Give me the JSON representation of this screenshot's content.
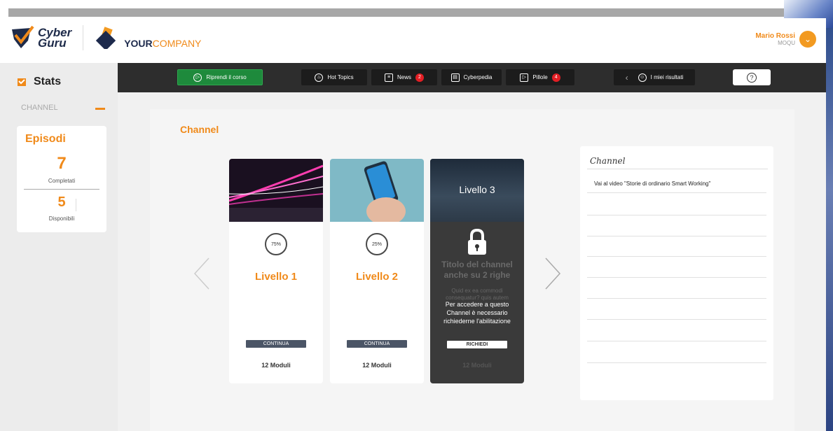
{
  "brand": {
    "cyber_line1": "Cyber",
    "cyber_line2": "Guru",
    "company_your": "YOUR",
    "company_rest": "COMPANY"
  },
  "user": {
    "name": "Mario Rossi",
    "org": "MOQU"
  },
  "sidebar": {
    "stats_label": "Stats",
    "channel_label": "CHANNEL"
  },
  "episodi": {
    "title": "Episodi",
    "completed_count": "7",
    "completed_label": "Completati",
    "available_count": "5",
    "available_label": "Disponibili"
  },
  "nav": {
    "riprendi": "Riprendi il corso",
    "hot_topics": "Hot Topics",
    "news": "News",
    "news_badge": "2",
    "cyberpedia": "Cyberpedia",
    "pillole": "Pillole",
    "pillole_badge": "4",
    "risultati": "I miei risultati"
  },
  "main": {
    "title": "Channel"
  },
  "cards": [
    {
      "level": "Livello 1",
      "progress": "75%",
      "cta": "CONTINUA",
      "modules": "12 Moduli"
    },
    {
      "level": "Livello 2",
      "progress": "25%",
      "cta": "CONTINUA",
      "modules": "12 Moduli"
    },
    {
      "level": "Livello 3",
      "ghost_title": "Titolo del channel anche su 2 righe",
      "ghost_sub": "Quid ex ea commodi consequatur? quis autem",
      "locked_msg": "Per accedere a questo Channel è necessario richiederne l'abilitazione",
      "cta": "RICHIEDI",
      "modules": "12 Moduli"
    }
  ],
  "side_panel": {
    "title": "Channel",
    "item": "Vai al video \"Storie di ordinario Smart Working\""
  },
  "colors": {
    "accent": "#f08a1a",
    "navbar": "#2d2d2d",
    "resume_green": "#1e8a3c",
    "badge_red": "#e31e24"
  }
}
